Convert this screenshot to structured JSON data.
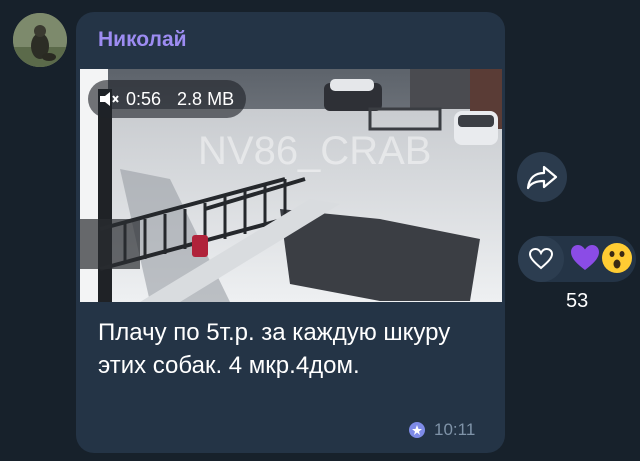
{
  "message": {
    "sender": "Николай",
    "video": {
      "duration": "0:56",
      "size": "2.8 MB",
      "watermark": "NV86_CRAB",
      "muted": true
    },
    "text": "Плачу по 5т.р. за каждую шкуру этих собак. 4 мкр.4дом.",
    "time": "10:11"
  },
  "reactions": {
    "count": "53",
    "emojis": [
      "purple-heart",
      "shocked-face"
    ]
  },
  "colors": {
    "background": "#17212b",
    "bubble": "#243446",
    "sender": "#9d8cf2",
    "meta": "#7f93a8"
  }
}
